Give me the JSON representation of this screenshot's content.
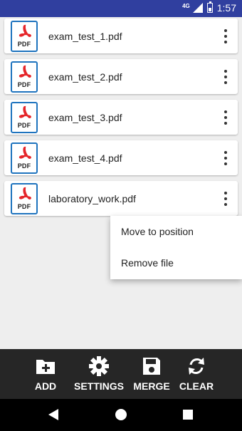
{
  "status_bar": {
    "network": "4G",
    "time": "1:57"
  },
  "files": [
    {
      "name": "exam_test_1.pdf",
      "icon_text": "PDF"
    },
    {
      "name": "exam_test_2.pdf",
      "icon_text": "PDF"
    },
    {
      "name": "exam_test_3.pdf",
      "icon_text": "PDF"
    },
    {
      "name": "exam_test_4.pdf",
      "icon_text": "PDF"
    },
    {
      "name": "laboratory_work.pdf",
      "icon_text": "PDF"
    }
  ],
  "popup_menu": {
    "items": [
      "Move to position",
      "Remove file"
    ]
  },
  "toolbar": {
    "add_label": "ADD",
    "settings_label": "SETTINGS",
    "merge_label": "MERGE",
    "clear_label": "CLEAR"
  },
  "colors": {
    "status_bar": "#303f9f",
    "toolbar": "#262626",
    "pdf_red": "#e5252a",
    "pdf_border": "#1e73be"
  }
}
